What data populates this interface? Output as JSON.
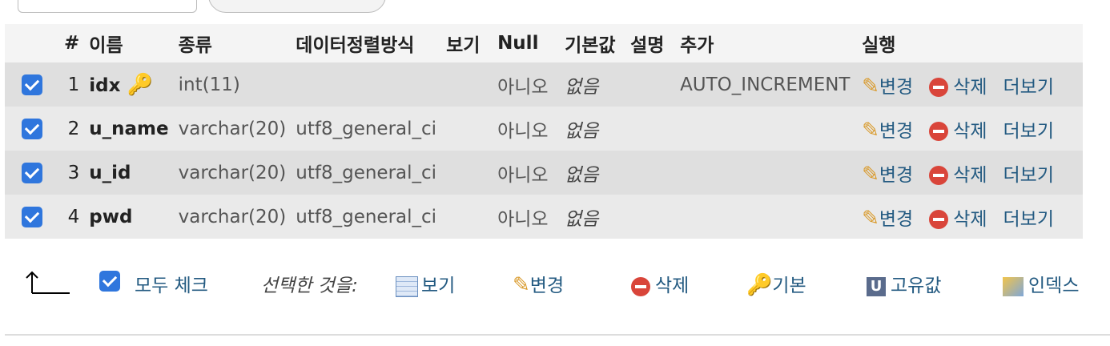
{
  "headers": [
    "#",
    "이름",
    "종류",
    "데이터정렬방식",
    "보기",
    "Null",
    "기본값",
    "설명",
    "추가",
    "실행"
  ],
  "rows": [
    {
      "num": "1",
      "name": "idx",
      "type": "int(11)",
      "collation": "",
      "null": "아니오",
      "default": "없음",
      "extra": "AUTO_INCREMENT",
      "primary": true
    },
    {
      "num": "2",
      "name": "u_name",
      "type": "varchar(20)",
      "collation": "utf8_general_ci",
      "null": "아니오",
      "default": "없음",
      "extra": "",
      "primary": false
    },
    {
      "num": "3",
      "name": "u_id",
      "type": "varchar(20)",
      "collation": "utf8_general_ci",
      "null": "아니오",
      "default": "없음",
      "extra": "",
      "primary": false
    },
    {
      "num": "4",
      "name": "pwd",
      "type": "varchar(20)",
      "collation": "utf8_general_ci",
      "null": "아니오",
      "default": "없음",
      "extra": "",
      "primary": false
    }
  ],
  "row_actions": {
    "change": "변경",
    "drop": "삭제",
    "more": "더보기"
  },
  "footer": {
    "check_all": "모두 체크",
    "with_selected": "선택한 것을:",
    "browse": "보기",
    "change": "변경",
    "drop": "삭제",
    "primary": "기본",
    "unique": "고유값",
    "index": "인덱스"
  },
  "colors": {
    "link": "#235a81",
    "checkbox": "#2f76dd",
    "row_odd": "#dfdfdf",
    "row_even": "#eaeaea"
  }
}
